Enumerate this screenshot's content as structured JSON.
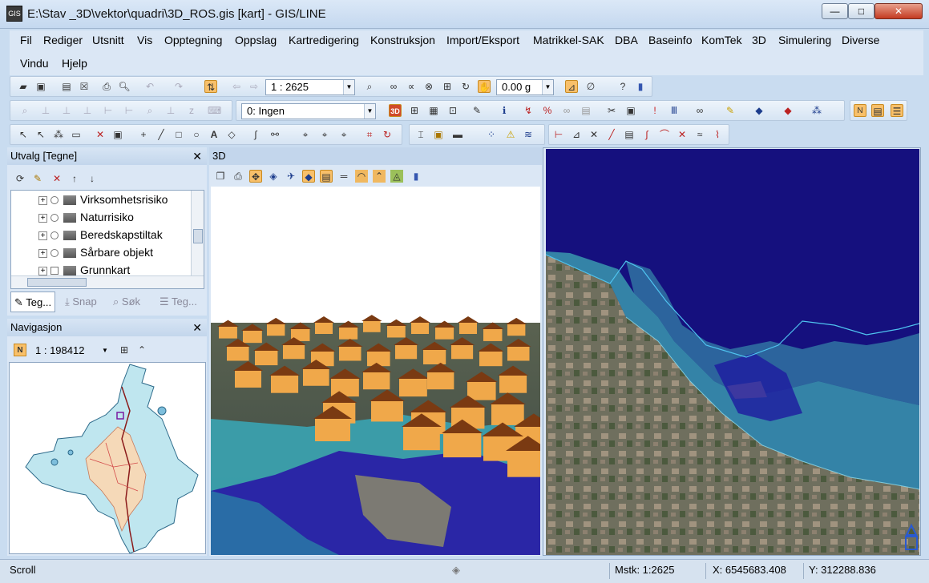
{
  "window": {
    "title": "E:\\Stav _3D\\vektor\\quadri\\3D_ROS.gis [kart] - GIS/LINE",
    "icon_text": "GIS"
  },
  "caption_buttons": {
    "minimize": "—",
    "maximize": "□",
    "close": "✕"
  },
  "menu": [
    "Fil",
    "Rediger",
    "Utsnitt",
    "Vis",
    "Opptegning",
    "Oppslag",
    "Kartredigering",
    "Konstruksjon",
    "Import/Eksport",
    "Matrikkel-SAK",
    "DBA",
    "Baseinfo",
    "KomTek",
    "3D",
    "Simulering",
    "Diverse",
    "Vindu",
    "Hjelp"
  ],
  "toolbar1": {
    "scale_value": "1 : 2625",
    "angle_value": "0.00 g"
  },
  "toolbar2": {
    "layer_value": "0: Ingen"
  },
  "utvalg_panel": {
    "title": "Utvalg [Tegne]",
    "items": [
      "Virksomhetsrisiko",
      "Naturrisiko",
      "Beredskapstiltak",
      "Sårbare objekt",
      "Grunnkart"
    ],
    "tabs": [
      "Teg...",
      "Snap",
      "Søk",
      "Teg..."
    ]
  },
  "nav_panel": {
    "title": "Navigasjon",
    "scale_value": "1 : 198412",
    "badge": "N"
  },
  "view3d": {
    "title": "3D"
  },
  "colors": {
    "sea": "#15107e",
    "flood_cyan": "#3fa9b6",
    "roof": "#f0a84a",
    "roof_dark": "#7a3a12"
  },
  "status": {
    "mode": "Scroll",
    "scale": "Mstk: 1:2625",
    "x": "X: 6545683.408",
    "y": "Y: 312288.836"
  }
}
